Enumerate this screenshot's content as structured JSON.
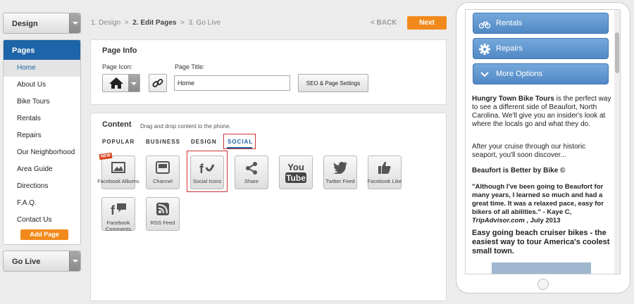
{
  "sidebar": {
    "design_label": "Design",
    "pages_header": "Pages",
    "pages": [
      "Home",
      "About Us",
      "Bike Tours",
      "Rentals",
      "Repairs",
      "Our Neighborhood",
      "Area Guide",
      "Directions",
      "F.A.Q.",
      "Contact Us"
    ],
    "add_page_label": "Add Page",
    "go_live_label": "Go Live"
  },
  "steps": {
    "step1": "1. Design",
    "sep1": ">",
    "step2": "2. Edit Pages",
    "sep2": ">",
    "step3": "3. Go Live",
    "back_label": "< BACK",
    "next_label": "Next"
  },
  "page_info": {
    "title": "Page Info",
    "icon_label": "Page Icon:",
    "title_label": "Page Title:",
    "title_value": "Home",
    "seo_button": "SEO & Page Settings"
  },
  "content": {
    "title": "Content",
    "subtitle": "Drag and drop content to the phone.",
    "tabs": [
      "POPULAR",
      "BUSINESS",
      "DESIGN",
      "SOCIAL"
    ],
    "active_tab": "SOCIAL",
    "widgets": [
      {
        "label": "Facebook Albums",
        "icon": "facebook-albums-icon",
        "badge": "NEW"
      },
      {
        "label": "Channel",
        "icon": "youtube-channel-icon"
      },
      {
        "label": "Social Icons",
        "icon": "social-icons-icon"
      },
      {
        "label": "Share",
        "icon": "share-icon"
      },
      {
        "label": "YouTube",
        "icon": "youtube-icon",
        "text": "You Tube"
      },
      {
        "label": "Twitter Feed",
        "icon": "twitter-bird-icon"
      },
      {
        "label": "Facebook Like",
        "icon": "thumbs-up-icon"
      },
      {
        "label": "Facebook Comments",
        "icon": "facebook-comments-icon"
      },
      {
        "label": "RSS Feed",
        "icon": "rss-icon"
      }
    ]
  },
  "phone": {
    "nav": [
      {
        "label": "Rentals",
        "icon": "bicycle-icon"
      },
      {
        "label": "Repairs",
        "icon": "gear-icon"
      },
      {
        "label": "More Options",
        "icon": "chevron-down-icon"
      }
    ],
    "intro_bold": "Hungry Town Bike Tours",
    "intro_rest": " is the perfect way to see a different side of Beaufort, North Carolina. We'll give you an insider's look at where the locals go and what they do.",
    "para2": "After your cruise through our historic seaport, you'll soon discover...",
    "heading": "Beaufort is Better by Bike ©",
    "quote": "\"Although I've been going to Beaufort for many years, I learned so much and  had a great time. It was a relaxed pace, easy for bikers of all abilities.\"",
    "quote_author": "  - Kaye C,",
    "quote_source": "TripAdvisor.com",
    "quote_date": " , July 2013",
    "tagline": "Easy going beach cruiser bikes - the easiest way to tour America's coolest small town."
  },
  "colors": {
    "accent_blue": "#1e64a8",
    "orange": "#f2891c",
    "nav_blue": "#5188c4",
    "highlight_red": "#cc3333"
  }
}
